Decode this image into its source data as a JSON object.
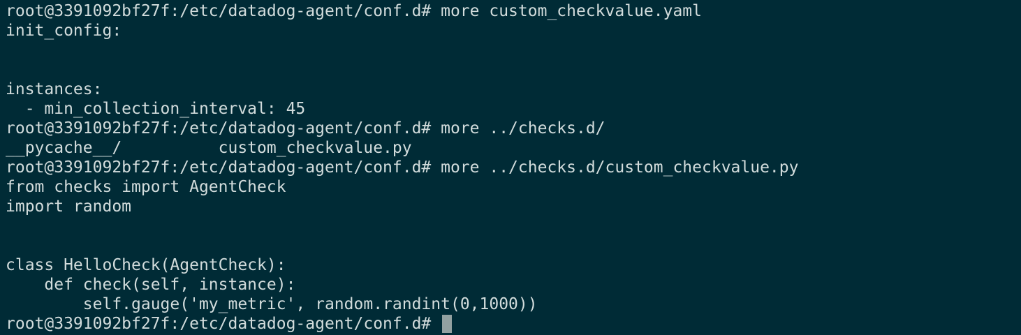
{
  "terminal": {
    "background_color": "#002b36",
    "text_color": "#d2dcdc",
    "cursor_color": "#93a1a1",
    "lines": [
      "root@3391092bf27f:/etc/datadog-agent/conf.d# more custom_checkvalue.yaml",
      "init_config:",
      "",
      "",
      "instances:",
      "  - min_collection_interval: 45",
      "root@3391092bf27f:/etc/datadog-agent/conf.d# more ../checks.d/",
      "__pycache__/          custom_checkvalue.py",
      "root@3391092bf27f:/etc/datadog-agent/conf.d# more ../checks.d/custom_checkvalue.py",
      "from checks import AgentCheck",
      "import random",
      "",
      "",
      "class HelloCheck(AgentCheck):",
      "    def check(self, instance):",
      "        self.gauge('my_metric', random.randint(0,1000))"
    ],
    "prompt": "root@3391092bf27f:/etc/datadog-agent/conf.d# "
  }
}
